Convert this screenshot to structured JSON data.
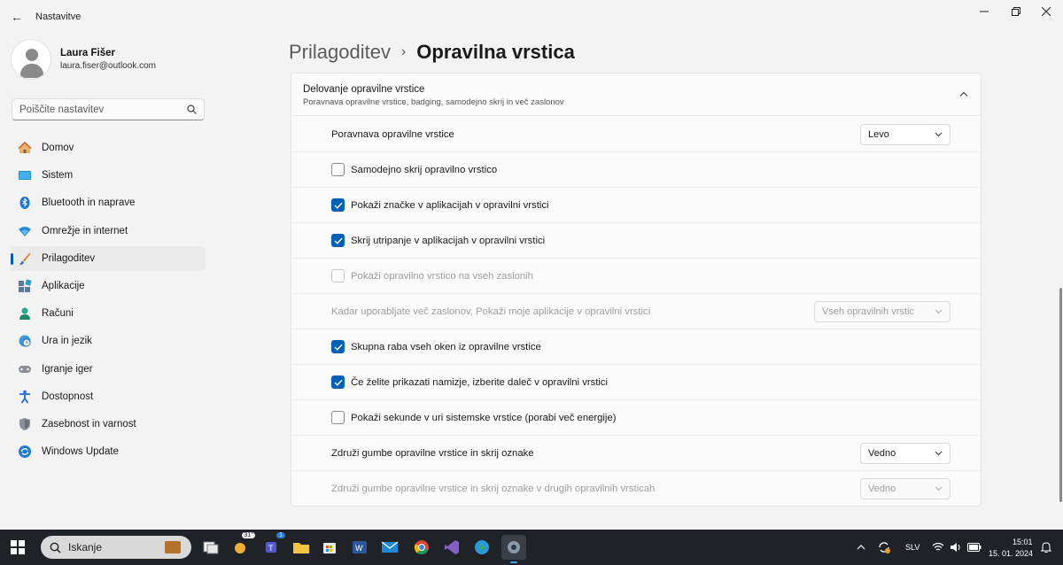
{
  "window": {
    "back_glyph": "←",
    "title": "Nastavitve",
    "controls": [
      "minimize-icon",
      "restore-icon",
      "close-icon"
    ]
  },
  "profile": {
    "name": "Laura Fišer",
    "email": "laura.fiser@outlook.com"
  },
  "search": {
    "placeholder": "Poiščite nastavitev"
  },
  "sidebar": {
    "items": [
      {
        "label": "Domov",
        "icon": "home-icon"
      },
      {
        "label": "Sistem",
        "icon": "system-icon"
      },
      {
        "label": "Bluetooth in naprave",
        "icon": "bluetooth-icon"
      },
      {
        "label": "Omrežje in internet",
        "icon": "wifi-icon"
      },
      {
        "label": "Prilagoditev",
        "icon": "brush-icon",
        "active": true
      },
      {
        "label": "Aplikacije",
        "icon": "apps-icon"
      },
      {
        "label": "Računi",
        "icon": "account-icon"
      },
      {
        "label": "Ura in jezik",
        "icon": "globe-clock-icon"
      },
      {
        "label": "Igranje iger",
        "icon": "gamepad-icon"
      },
      {
        "label": "Dostopnost",
        "icon": "accessibility-icon"
      },
      {
        "label": "Zasebnost in varnost",
        "icon": "shield-icon"
      },
      {
        "label": "Windows Update",
        "icon": "update-icon"
      }
    ]
  },
  "breadcrumb": {
    "parent": "Prilagoditev",
    "separator": "›",
    "current": "Opravilna vrstica"
  },
  "section": {
    "title": "Delovanje opravilne vrstice",
    "subtitle": "Poravnava opravilne vrstice, badging, samodejno skrij in več zaslonov",
    "expanded": true
  },
  "settings": {
    "alignment": {
      "label": "Poravnava opravilne vrstice",
      "value": "Levo"
    },
    "autohide": {
      "label": "Samodejno skrij opravilno vrstico",
      "checked": false
    },
    "badges": {
      "label": "Pokaži značke v aplikacijah v opravilni vrstici",
      "checked": true
    },
    "flashing": {
      "label": "Skrij utripanje v aplikacijah v opravilni vrstici",
      "checked": true
    },
    "all_displays": {
      "label": "Pokaži opravilno vrstico na vseh zaslonih",
      "checked": false,
      "disabled": true
    },
    "multi_display": {
      "label": "Kadar uporabljate več zaslonov, Pokaži moje aplikacije v opravilni vrstici",
      "value": "Vseh opravilnih vrstic",
      "disabled": true
    },
    "share_windows": {
      "label": "Skupna raba vseh oken iz opravilne vrstice",
      "checked": true
    },
    "far_corner": {
      "label": "Če želite prikazati namizje, izberite daleč v opravilni vrstici",
      "checked": true
    },
    "seconds": {
      "label": "Pokaži sekunde v uri sistemske vrstice (porabi več energije)",
      "checked": false
    },
    "combine": {
      "label": "Združi gumbe opravilne vrstice in skrij oznake",
      "value": "Vedno"
    },
    "combine_other": {
      "label": "Združi gumbe opravilne vrstice in skrij oznake v drugih opravilnih vrsticah",
      "value": "Vedno",
      "disabled": true
    }
  },
  "taskbar": {
    "search_label": "Iskanje",
    "weather_temp": "31°",
    "teams_badge": "1",
    "language": "SLV",
    "time": "15:01",
    "date": "15. 01. 2024",
    "colors": {
      "background": "#1f2328",
      "accent": "#005fb8"
    }
  }
}
